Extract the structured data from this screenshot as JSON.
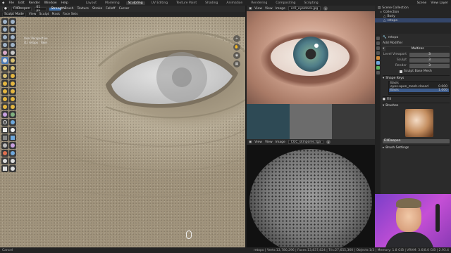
{
  "menu": [
    "File",
    "Edit",
    "Render",
    "Window",
    "Help"
  ],
  "workspaces": [
    "Layout",
    "Modeling",
    "Sculpting",
    "UV Editing",
    "Texture Paint",
    "Shading",
    "Animation",
    "Rendering",
    "Compositing",
    "Scripting"
  ],
  "active_workspace": "Sculpting",
  "scene": "Scene",
  "view_layer": "View Layer",
  "tool_header": {
    "brush_name": "FillDeepen",
    "radius": "61 px",
    "strength": "Strength",
    "menus": [
      "Brush",
      "Texture",
      "Stroke",
      "Falloff",
      "Cursor"
    ]
  },
  "viewport_header": {
    "mode": "Sculpt Mode",
    "menus": [
      "View",
      "Sculpt",
      "Mask",
      "Face Sets"
    ]
  },
  "viewport_info": {
    "line1": "User Perspective",
    "line2": "(1) retopo : Fake"
  },
  "image_panels": [
    {
      "menus": [
        "View",
        "View",
        "Image"
      ],
      "filename": "cc0_eyestock.jpg"
    },
    {
      "menus": [
        "View",
        "View",
        "Image"
      ],
      "filename": "CGC_skinpores.tga"
    }
  ],
  "outliner": {
    "rows": [
      "Scene Collection",
      "Collection",
      "Body",
      "retopo"
    ]
  },
  "properties": {
    "object_name": "retopo",
    "section_modifier": "Add Modifier",
    "modifier_name": "Multires",
    "rows": [
      {
        "label": "Level Viewport",
        "value": "3"
      },
      {
        "label": "Sculpt",
        "value": "3"
      },
      {
        "label": "Render",
        "value": "3"
      }
    ],
    "checkbox_label": "Sculpt Base Mesh",
    "shape_keys_title": "Shape Keys",
    "shape_keys": [
      "Basis",
      "eyes-open_mesh.closed",
      "Basis"
    ],
    "shape_values": [
      "",
      "0.000",
      "1.000"
    ],
    "brush_panel": "Fill",
    "brushes_title": "Brushes",
    "brush_selected": "FillDeepen",
    "brush_settings": "Brush Settings"
  },
  "status": {
    "left": "Cancel",
    "right": "retopo | Verts:13,780,296 | Faces:13,837,824 | Tris:27,655,360 | Objects:1/3 | Memory: 1.8 GiB | VRAM: 3.6/8.0 GiB | 2.93.4"
  }
}
